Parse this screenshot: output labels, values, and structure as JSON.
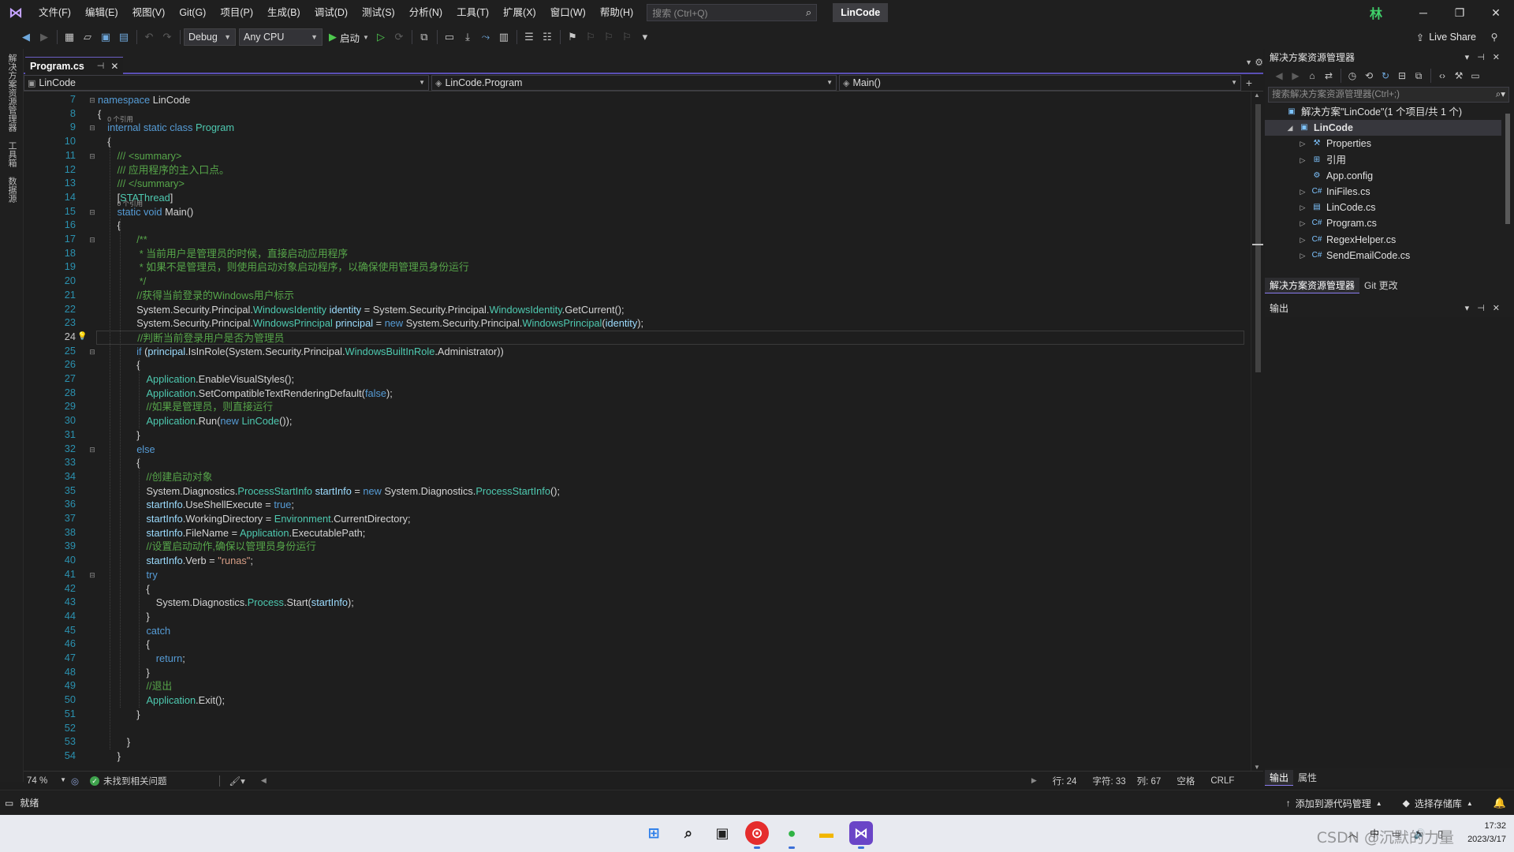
{
  "titlebar": {
    "menu": [
      "文件(F)",
      "编辑(E)",
      "视图(V)",
      "Git(G)",
      "项目(P)",
      "生成(B)",
      "调试(D)",
      "测试(S)",
      "分析(N)",
      "工具(T)",
      "扩展(X)",
      "窗口(W)",
      "帮助(H)"
    ],
    "search_placeholder": "搜索 (Ctrl+Q)",
    "solution_name": "LinCode",
    "avatar_text": "林",
    "controls": {
      "minimize": "─",
      "restore": "❐",
      "close": "✕"
    }
  },
  "toolbar": {
    "configuration": "Debug",
    "platform": "Any CPU",
    "run_label": "启动",
    "live_share": "Live Share"
  },
  "left_strip": {
    "tabs": [
      "解决方案资源管理器",
      "工具箱",
      "数据源"
    ]
  },
  "editor": {
    "tab": {
      "title": "Program.cs",
      "pin": "⊣",
      "close": "✕"
    },
    "nav": {
      "project": "LinCode",
      "type": "LinCode.Program",
      "member": "Main()"
    },
    "line_numbers": [
      7,
      8,
      9,
      10,
      11,
      12,
      13,
      14,
      15,
      16,
      17,
      18,
      19,
      20,
      21,
      22,
      23,
      24,
      25,
      26,
      27,
      28,
      29,
      30,
      31,
      32,
      33,
      34,
      35,
      36,
      37,
      38,
      39,
      40,
      41,
      42,
      43,
      44,
      45,
      46,
      47,
      48,
      49,
      50,
      51,
      52,
      53,
      54
    ],
    "current_line": 24,
    "ref_hint": "0 个引用",
    "lines": [
      [
        [
          "kw",
          "namespace "
        ],
        [
          "",
          "LinCode"
        ]
      ],
      [
        [
          "",
          "{"
        ]
      ],
      [
        [
          "kw",
          "internal static class "
        ],
        [
          "ty",
          "Program"
        ]
      ],
      [
        [
          "",
          "{"
        ]
      ],
      [
        [
          "cm",
          "/// <summary>"
        ]
      ],
      [
        [
          "cm",
          "/// 应用程序的主入口点。"
        ]
      ],
      [
        [
          "cm",
          "/// </summary>"
        ]
      ],
      [
        [
          "",
          "["
        ],
        [
          "ty",
          "STAThread"
        ],
        [
          "",
          "]"
        ]
      ],
      [
        [
          "kw",
          "static void "
        ],
        [
          "",
          "Main()"
        ]
      ],
      [
        [
          "",
          "{"
        ]
      ],
      [
        [
          "cm",
          "/**"
        ]
      ],
      [
        [
          "cm",
          " * 当前用户是管理员的时候，直接启动应用程序"
        ]
      ],
      [
        [
          "cm",
          " * 如果不是管理员，则使用启动对象启动程序，以确保使用管理员身份运行"
        ]
      ],
      [
        [
          "cm",
          " */"
        ]
      ],
      [
        [
          "cm",
          "//获得当前登录的Windows用户标示"
        ]
      ],
      [
        [
          "",
          "System.Security.Principal."
        ],
        [
          "ty",
          "WindowsIdentity "
        ],
        [
          "id",
          "identity"
        ],
        [
          "",
          " = System.Security.Principal."
        ],
        [
          "ty",
          "WindowsIdentity"
        ],
        [
          "",
          ".GetCurrent();"
        ]
      ],
      [
        [
          "",
          "System.Security.Principal."
        ],
        [
          "ty",
          "WindowsPrincipal "
        ],
        [
          "id",
          "principal"
        ],
        [
          "",
          " = "
        ],
        [
          "kw",
          "new "
        ],
        [
          "",
          "System.Security.Principal."
        ],
        [
          "ty",
          "WindowsPrincipal"
        ],
        [
          "",
          "("
        ],
        [
          "id",
          "identity"
        ],
        [
          "",
          ");"
        ]
      ],
      [
        [
          "cm",
          "//判断当前登录用户是否为管理员"
        ]
      ],
      [
        [
          "kw",
          "if "
        ],
        [
          "",
          "("
        ],
        [
          "id",
          "principal"
        ],
        [
          "",
          ".IsInRole(System.Security.Principal."
        ],
        [
          "ty",
          "WindowsBuiltInRole"
        ],
        [
          "",
          ".Administrator))"
        ]
      ],
      [
        [
          "",
          "{"
        ]
      ],
      [
        [
          "ty",
          "Application"
        ],
        [
          "",
          ".EnableVisualStyles();"
        ]
      ],
      [
        [
          "ty",
          "Application"
        ],
        [
          "",
          ".SetCompatibleTextRenderingDefault("
        ],
        [
          "kw",
          "false"
        ],
        [
          "",
          ");"
        ]
      ],
      [
        [
          "cm",
          "//如果是管理员，则直接运行"
        ]
      ],
      [
        [
          "ty",
          "Application"
        ],
        [
          "",
          ".Run("
        ],
        [
          "kw",
          "new "
        ],
        [
          "ty",
          "LinCode"
        ],
        [
          "",
          "());"
        ]
      ],
      [
        [
          "",
          "}"
        ]
      ],
      [
        [
          "kw",
          "else"
        ]
      ],
      [
        [
          "",
          "{"
        ]
      ],
      [
        [
          "cm",
          "//创建启动对象"
        ]
      ],
      [
        [
          "",
          "System.Diagnostics."
        ],
        [
          "ty",
          "ProcessStartInfo "
        ],
        [
          "id",
          "startInfo"
        ],
        [
          "",
          " = "
        ],
        [
          "kw",
          "new "
        ],
        [
          "",
          "System.Diagnostics."
        ],
        [
          "ty",
          "ProcessStartInfo"
        ],
        [
          "",
          "();"
        ]
      ],
      [
        [
          "id",
          "startInfo"
        ],
        [
          "",
          ".UseShellExecute = "
        ],
        [
          "kw",
          "true"
        ],
        [
          "",
          ";"
        ]
      ],
      [
        [
          "id",
          "startInfo"
        ],
        [
          "",
          ".WorkingDirectory = "
        ],
        [
          "ty",
          "Environment"
        ],
        [
          "",
          ".CurrentDirectory;"
        ]
      ],
      [
        [
          "id",
          "startInfo"
        ],
        [
          "",
          ".FileName = "
        ],
        [
          "ty",
          "Application"
        ],
        [
          "",
          ".ExecutablePath;"
        ]
      ],
      [
        [
          "cm",
          "//设置启动动作,确保以管理员身份运行"
        ]
      ],
      [
        [
          "id",
          "startInfo"
        ],
        [
          "",
          ".Verb = "
        ],
        [
          "st",
          "\"runas\""
        ],
        [
          "",
          ";"
        ]
      ],
      [
        [
          "kw",
          "try"
        ]
      ],
      [
        [
          "",
          "{"
        ]
      ],
      [
        [
          "",
          "System.Diagnostics."
        ],
        [
          "ty",
          "Process"
        ],
        [
          "",
          ".Start("
        ],
        [
          "id",
          "startInfo"
        ],
        [
          "",
          ");"
        ]
      ],
      [
        [
          "",
          "}"
        ]
      ],
      [
        [
          "kw",
          "catch"
        ]
      ],
      [
        [
          "",
          "{"
        ]
      ],
      [
        [
          "kw",
          "return"
        ],
        [
          "",
          ";"
        ]
      ],
      [
        [
          "",
          "}"
        ]
      ],
      [
        [
          "cm",
          "//退出"
        ]
      ],
      [
        [
          "ty",
          "Application"
        ],
        [
          "",
          ".Exit();"
        ]
      ],
      [
        [
          "",
          "}"
        ]
      ],
      [
        [
          "",
          ""
        ]
      ],
      [
        [
          "",
          "}"
        ]
      ],
      [
        [
          "",
          "}"
        ]
      ]
    ],
    "indents": [
      0,
      0,
      1,
      1,
      2,
      2,
      2,
      2,
      2,
      2,
      4,
      4,
      4,
      4,
      4,
      4,
      4,
      4,
      4,
      4,
      5,
      5,
      5,
      5,
      4,
      4,
      4,
      5,
      5,
      5,
      5,
      5,
      5,
      5,
      5,
      5,
      6,
      5,
      5,
      5,
      6,
      5,
      5,
      5,
      4,
      0,
      3,
      2
    ],
    "fold_rows": [
      0,
      2,
      4,
      8,
      10,
      18,
      25,
      34
    ],
    "status": {
      "zoom": "74 %",
      "issues": "未找到相关问题",
      "line": "行: 24",
      "char": "字符: 33",
      "col": "列: 67",
      "whitespace": "空格",
      "eol": "CRLF"
    }
  },
  "solution_explorer": {
    "title": "解决方案资源管理器",
    "search_placeholder": "搜索解决方案资源管理器(Ctrl+;)",
    "tree": [
      {
        "label": "解决方案\"LinCode\"(1 个项目/共 1 个)",
        "depth": 0,
        "expander": "",
        "icon": "solution-icon",
        "glyph": "▣",
        "selected": false
      },
      {
        "label": "LinCode",
        "depth": 1,
        "expander": "◢",
        "icon": "csharp-project-icon",
        "glyph": "▣",
        "selected": true
      },
      {
        "label": "Properties",
        "depth": 2,
        "expander": "▷",
        "icon": "wrench-icon",
        "glyph": "⚒",
        "selected": false
      },
      {
        "label": "引用",
        "depth": 2,
        "expander": "▷",
        "icon": "references-icon",
        "glyph": "⊞",
        "selected": false
      },
      {
        "label": "App.config",
        "depth": 2,
        "expander": "",
        "icon": "config-file-icon",
        "glyph": "⚙",
        "selected": false
      },
      {
        "label": "IniFiles.cs",
        "depth": 2,
        "expander": "▷",
        "icon": "csharp-file-icon",
        "glyph": "C#",
        "selected": false
      },
      {
        "label": "LinCode.cs",
        "depth": 2,
        "expander": "▷",
        "icon": "form-file-icon",
        "glyph": "▤",
        "selected": false
      },
      {
        "label": "Program.cs",
        "depth": 2,
        "expander": "▷",
        "icon": "csharp-file-icon",
        "glyph": "C#",
        "selected": false
      },
      {
        "label": "RegexHelper.cs",
        "depth": 2,
        "expander": "▷",
        "icon": "csharp-file-icon",
        "glyph": "C#",
        "selected": false
      },
      {
        "label": "SendEmailCode.cs",
        "depth": 2,
        "expander": "▷",
        "icon": "csharp-file-icon",
        "glyph": "C#",
        "selected": false
      }
    ],
    "tabs": [
      "解决方案资源管理器",
      "Git 更改"
    ]
  },
  "output_panel": {
    "title": "输出",
    "bottom_tabs": [
      "输出",
      "属性"
    ]
  },
  "statusbar": {
    "ready": "就绪",
    "add_source_control": "添加到源代码管理",
    "select_repo": "选择存储库"
  },
  "taskbar": {
    "clock_time": "17:32",
    "clock_date": "2023/3/17",
    "watermark": "CSDN @沉默的力量"
  },
  "colors": {
    "accent": "#6b5fc4",
    "keyword": "#569cd6",
    "type": "#4ec9b0",
    "comment": "#57a64a",
    "string": "#d69d85",
    "line_number": "#2b91af"
  }
}
